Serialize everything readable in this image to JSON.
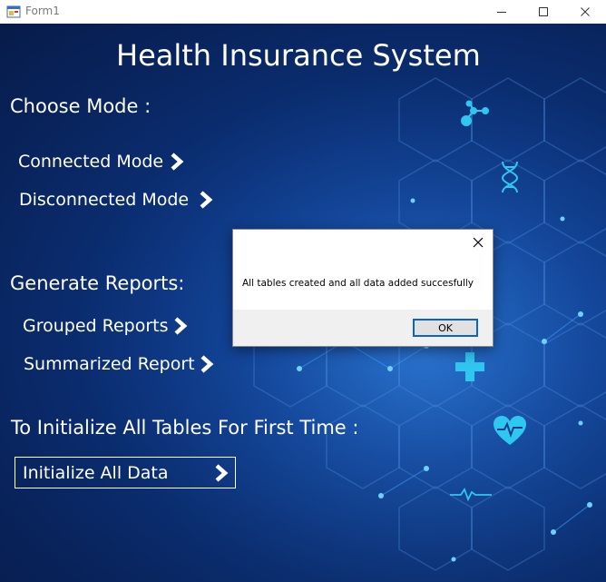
{
  "window": {
    "title": "Form1"
  },
  "form": {
    "heading": "Health Insurance System",
    "choose_mode_label": "Choose Mode :",
    "connected_mode": "Connected Mode",
    "disconnected_mode": "Disconnected Mode",
    "generate_reports_label": "Generate Reports:",
    "grouped_reports": "Grouped Reports",
    "summarized_report": "Summarized Report",
    "initialize_label": "To Initialize All Tables For First Time :",
    "initialize_button": "Initialize All Data"
  },
  "dialog": {
    "message": "All tables created and all data added succesfully",
    "ok_label": "OK"
  },
  "colors": {
    "background_dark": "#071b49",
    "background_glow": "#1c5fbf",
    "icon_cyan": "#2fc6f0",
    "dialog_ok_border": "#0a64c8"
  }
}
